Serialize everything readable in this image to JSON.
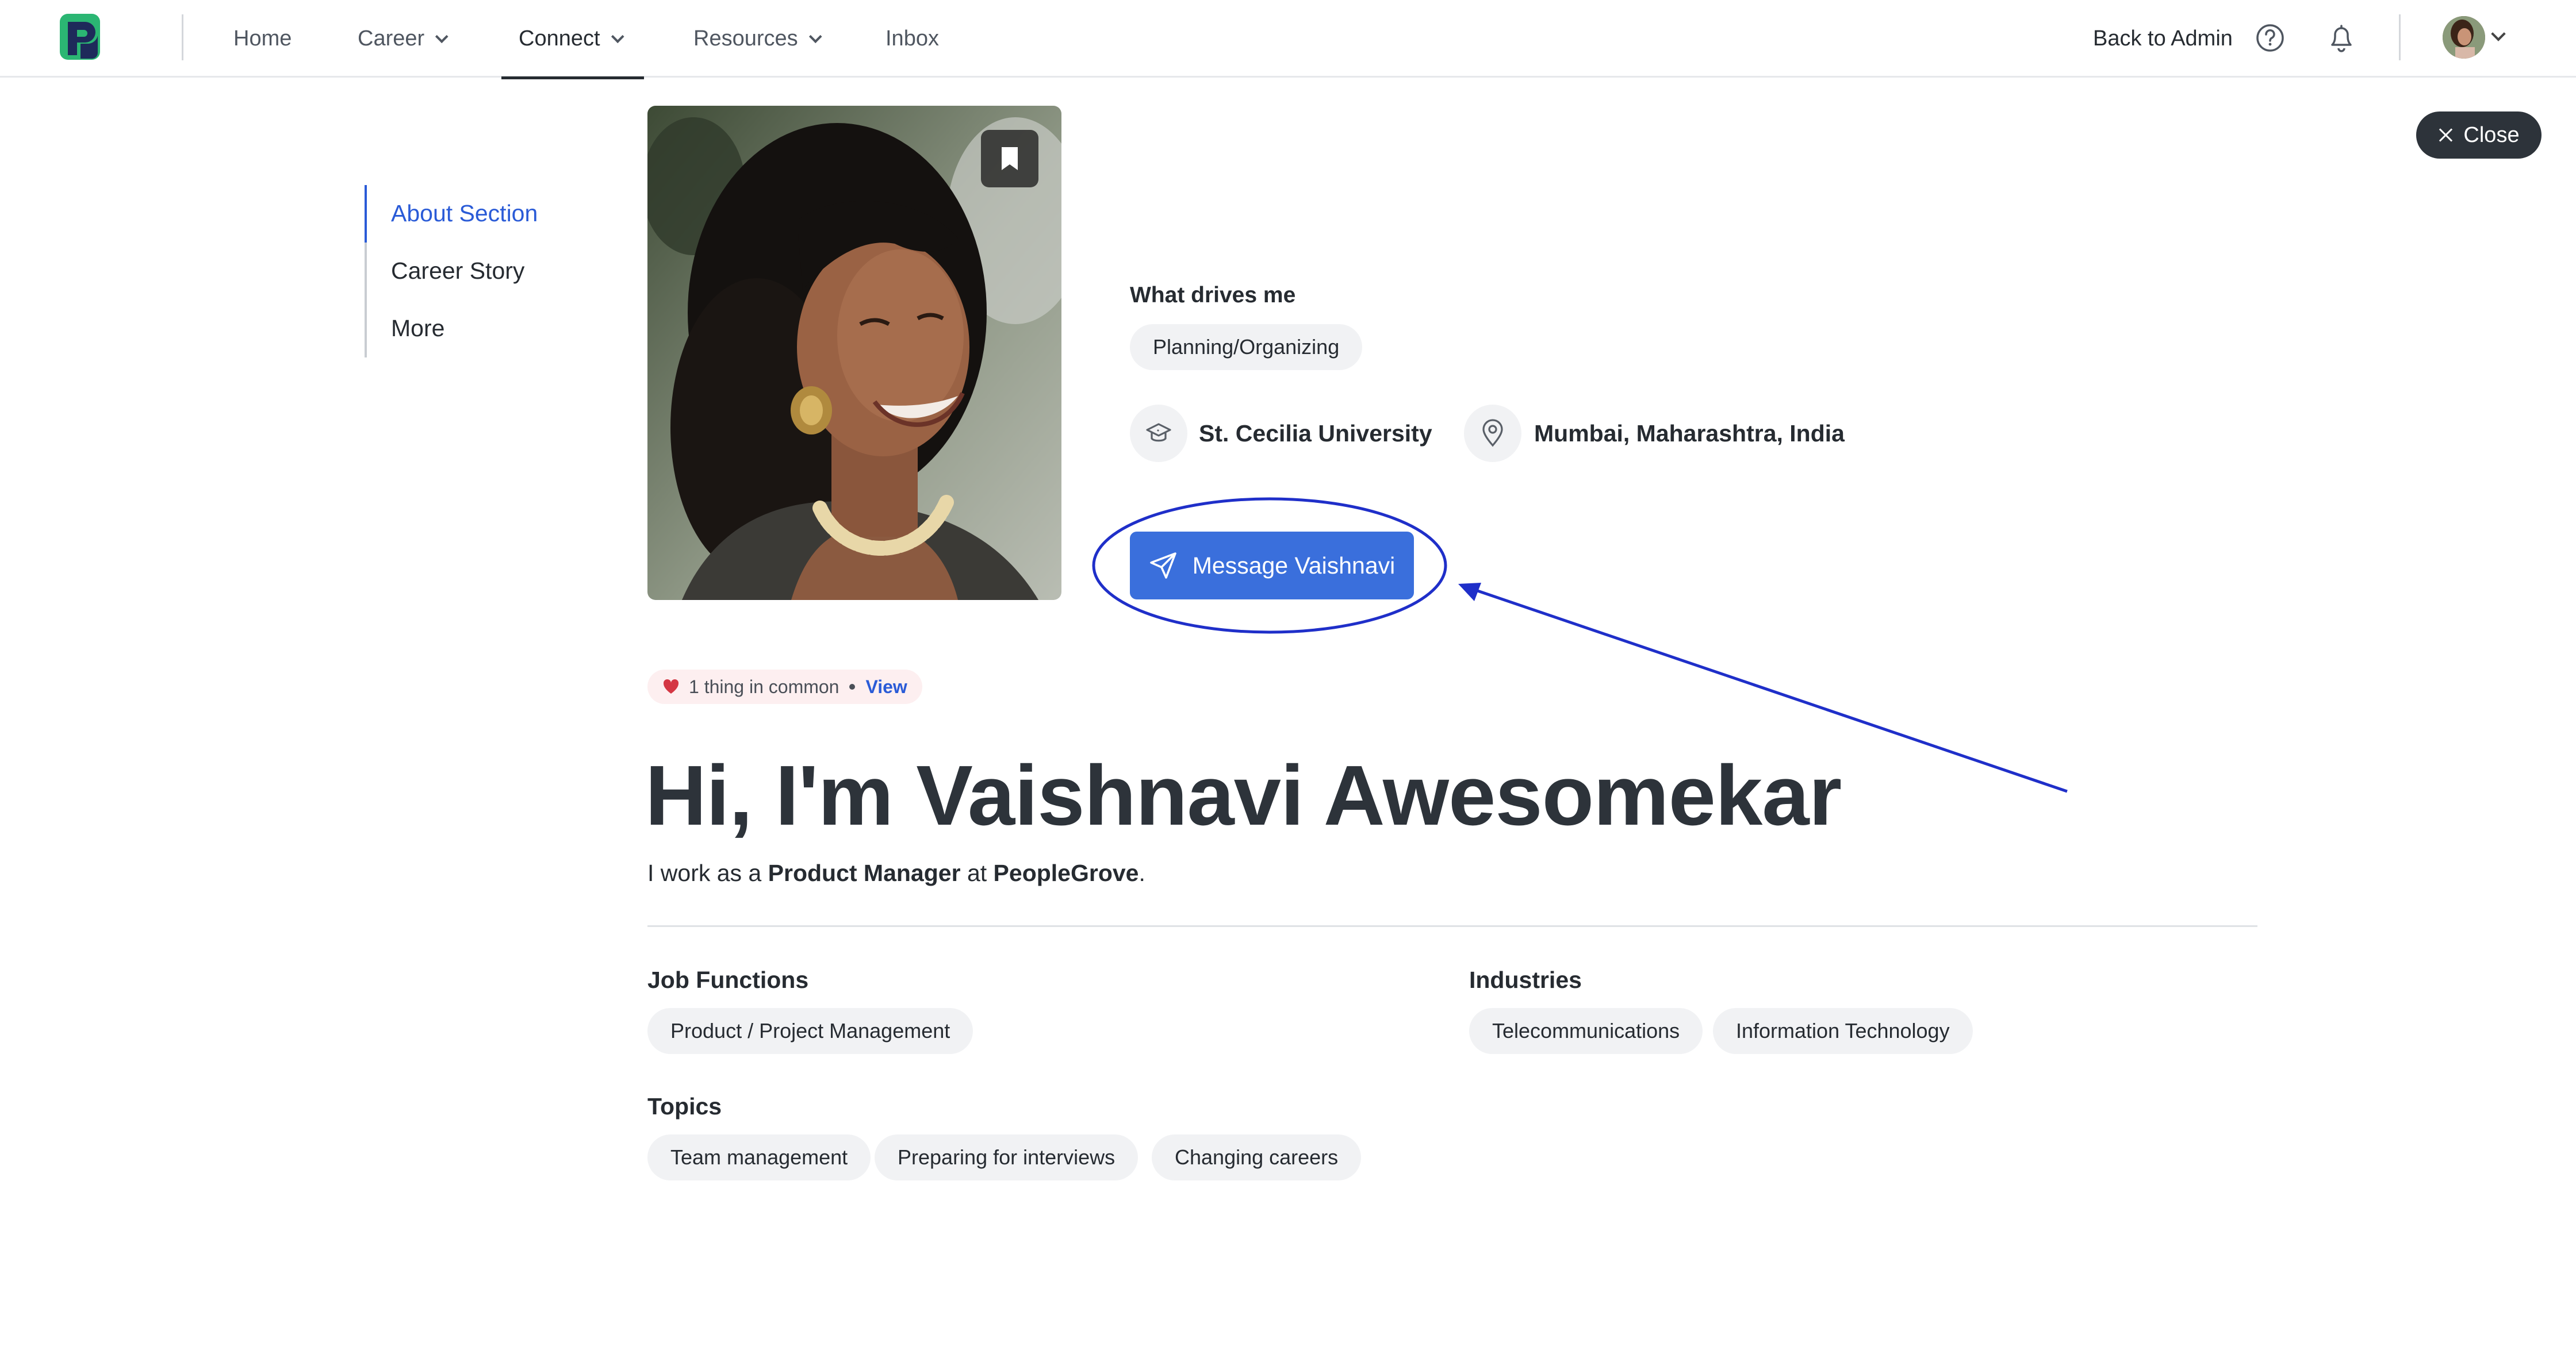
{
  "nav": {
    "items": [
      {
        "label": "Home"
      },
      {
        "label": "Career"
      },
      {
        "label": "Connect"
      },
      {
        "label": "Resources"
      },
      {
        "label": "Inbox"
      }
    ],
    "back_to_admin": "Back to Admin"
  },
  "close_label": "Close",
  "sidenav": {
    "items": [
      {
        "label": "About Section"
      },
      {
        "label": "Career Story"
      },
      {
        "label": "More"
      }
    ]
  },
  "profile": {
    "drives_label": "What drives me",
    "drives": [
      "Planning/Organizing"
    ],
    "school": "St. Cecilia University",
    "location": "Mumbai, Maharashtra, India",
    "message_button": "Message Vaishnavi",
    "common": {
      "text": "1 thing in common",
      "view": "View"
    },
    "headline": "Hi, I'm Vaishnavi Awesomekar",
    "sub": {
      "prefix": "I work as a",
      "role": "Product Manager",
      "mid": "at",
      "company": "PeopleGrove",
      "suffix": "."
    }
  },
  "sections": {
    "job_functions": {
      "label": "Job Functions",
      "items": [
        "Product / Project Management"
      ]
    },
    "industries": {
      "label": "Industries",
      "items": [
        "Telecommunications",
        "Information Technology"
      ]
    },
    "topics": {
      "label": "Topics",
      "items": [
        "Team management",
        "Preparing for interviews",
        "Changing careers"
      ]
    }
  },
  "colors": {
    "accent": "#2a5bd7",
    "button": "#3a6fdc",
    "annotation": "#1f2fc9",
    "chip_bg": "#f1f2f4",
    "dark": "#2d333a"
  }
}
